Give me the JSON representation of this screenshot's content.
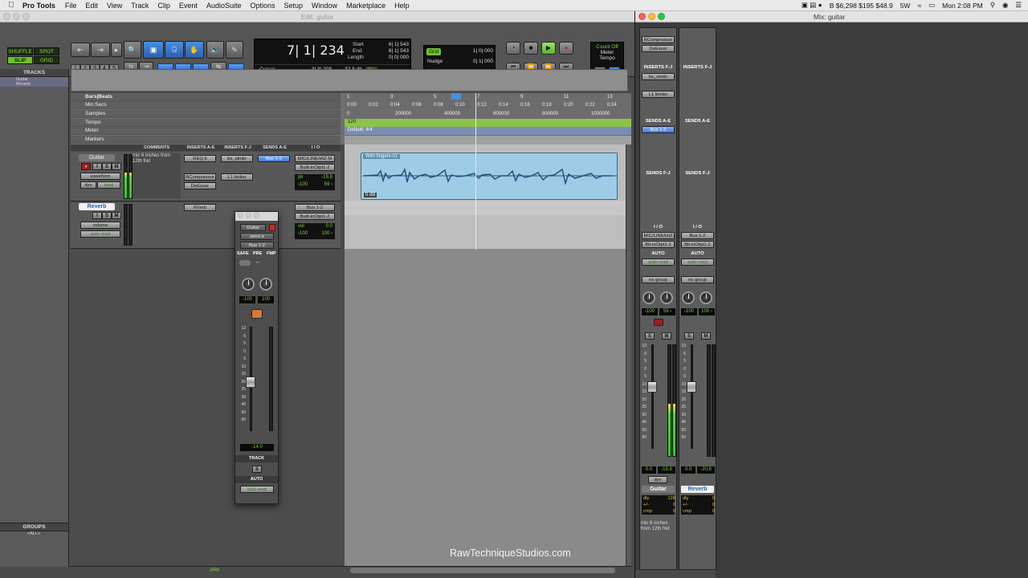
{
  "menubar": {
    "app": "Pro Tools",
    "items": [
      "File",
      "Edit",
      "View",
      "Track",
      "Clip",
      "Event",
      "AudioSuite",
      "Options",
      "Setup",
      "Window",
      "Marketplace",
      "Help"
    ],
    "status": {
      "stocks": "B $6,298  $195  $48.9",
      "wifi_text": "5W",
      "clock": "Mon 2:08 PM"
    }
  },
  "edit_window": {
    "title": "Edit: guitar",
    "modes": {
      "shuffle": "SHUFFLE",
      "spot": "SPOT",
      "slip": "SLIP",
      "grid": "GRID"
    },
    "zoom_presets": [
      "1",
      "2",
      "3",
      "4",
      "5"
    ],
    "counter": {
      "main": "7| 1| 234",
      "start_label": "Start",
      "start": "6| 1| 543",
      "end_label": "End",
      "end": "6| 1| 543",
      "length_label": "Length",
      "length": "0| 0| 000",
      "cursor_label": "Cursor",
      "cursor": "3| 3| 208",
      "cursor_db": "-32.5 db",
      "dly": "Dly"
    },
    "grid": {
      "label": "Grid",
      "value": "1| 0| 000",
      "nudge_label": "Nudge",
      "nudge_value": "0| 1| 000"
    },
    "countoff": {
      "line1": "Count Off",
      "line2": "Meter",
      "line3": "Tempo"
    },
    "tracks_panel": {
      "title": "TRACKS",
      "items": [
        "Guitar",
        "Reverb"
      ]
    },
    "groups_panel": {
      "title": "GROUPS",
      "items": [
        "<ALL>"
      ]
    },
    "rulers": {
      "labels": [
        "Bars|Beats",
        "Min:Secs",
        "Samples",
        "Tempo",
        "Meter",
        "Markers"
      ],
      "bars": [
        "1",
        "3",
        "5",
        "7",
        "9",
        "11",
        "13"
      ],
      "secs": [
        "0:00",
        "0:02",
        "0:04",
        "0:06",
        "0:08",
        "0:10",
        "0:12",
        "0:14",
        "0:16",
        "0:18",
        "0:20",
        "0:22",
        "0:24"
      ],
      "samples": [
        "0",
        "200000",
        "400000",
        "600000",
        "800000",
        "1000000"
      ],
      "tempo": "120",
      "meter": "Default: 4/4"
    },
    "columns": [
      "COMMENTS",
      "INSERTS A-E",
      "INSERTS F-J",
      "SENDS A-E",
      "I / O"
    ],
    "tracks": [
      {
        "name": "Guitar",
        "view": "waveform",
        "dyn": "dyn",
        "auto": "read",
        "comment": "mic 6 inches from 12th fret",
        "inserts_ae": [
          "REQ 6",
          "RCompressor",
          "DeEsser"
        ],
        "inserts_fj": [
          "bx_stmkr",
          "L1 limiter"
        ],
        "sends_ae": [
          "Bus 1-2"
        ],
        "io_in": "MIC/LINE/HIZ M",
        "io_out": "Built-inOtpt1-2",
        "pk_label": "pk",
        "pk_value": "-15.8",
        "pan_l": "‹100",
        "pan_r": "59 ›"
      },
      {
        "name": "Reverb",
        "view": "volume",
        "auto": "auto read",
        "inserts_ae": [
          "RVerb"
        ],
        "io_in": "Bus 1-2",
        "io_out": "Built-inOtpt1-2",
        "vol_label": "vol",
        "vol_value": "0.0",
        "pan_l": "‹100",
        "pan_r": "100 ›"
      }
    ],
    "clip": {
      "name": "With fingers-01",
      "gain": "0 dB"
    },
    "status_text": "play",
    "watermark": "RawTechniqueStudios.com"
  },
  "send_window": {
    "track": "Guitar",
    "send": "send a",
    "bus": "Bus 1-2",
    "safe": "SAFE",
    "pre": "PRE",
    "fmp": "FMP",
    "pan_l": "-100",
    "pan_r": "100",
    "level": "-14.0",
    "track_label": "TRACK",
    "s_label": "S",
    "auto_label": "AUTO",
    "auto_value": "auto read",
    "scale": [
      "12",
      "6",
      "5",
      "0",
      "5",
      "10",
      "15",
      "20",
      "25",
      "30",
      "40",
      "50",
      "60"
    ],
    "meter_level": 0
  },
  "mix_window": {
    "title": "Mix: guitar",
    "strips": [
      {
        "name": "Guitar",
        "inserts_ae": [
          "RCompressor",
          "DeEsser"
        ],
        "inserts_fj_label": "INSERTS F-J",
        "inserts_fj": [
          "bx_stmkr",
          "L1 limiter"
        ],
        "sends_ae_label": "SENDS A-E",
        "sends_ae": [
          "Bus 1-2"
        ],
        "sends_fj_label": "SENDS F-J",
        "io_label": "I / O",
        "io_in": "MIC/LINE/HIZ",
        "io_out": "Blt-inOtpt1-2",
        "auto_label": "AUTO",
        "auto": "auto read",
        "group": "no group",
        "pan_l": "‹100",
        "pan_r": "59 ›",
        "solo": "S",
        "mute": "M",
        "vol": "0.0",
        "peak": "-15.8",
        "dyn": "dyn",
        "dly_label": "dly",
        "dly": "128",
        "plusminus_label": "+/-",
        "plusminus": "0",
        "cmp_label": "cmp",
        "cmp": "0",
        "comment": "mic 6 inches from 12th fret",
        "meter_level": 0.47
      },
      {
        "name": "Reverb",
        "inserts_fj_label": "INSERTS F-J",
        "sends_ae_label": "SENDS A-E",
        "sends_fj_label": "SENDS F-J",
        "io_label": "I / O",
        "io_in": "Bus 1-2",
        "io_out": "Blt-inOtpt1-2",
        "auto_label": "AUTO",
        "auto": "auto read",
        "group": "no group",
        "pan_l": "‹100",
        "pan_r": "100 ›",
        "solo": "S",
        "mute": "M",
        "vol": "0.0",
        "peak": "-20.8",
        "dly_label": "dly",
        "dly": "0",
        "plusminus_label": "+/-",
        "plusminus": "0",
        "cmp_label": "cmp",
        "cmp": "0",
        "meter_level": 0
      }
    ],
    "header_labels": [
      "INSERTS F-J",
      "INSERTS F-J"
    ],
    "scale": [
      "12",
      "6",
      "5",
      "0",
      "5",
      "10",
      "15",
      "20",
      "25",
      "30",
      "40",
      "50",
      "60"
    ]
  },
  "colors": {
    "accent_green": "#7cd33a",
    "clip_blue": "#9ecbe6",
    "selection_blue": "#2a5fb0"
  }
}
